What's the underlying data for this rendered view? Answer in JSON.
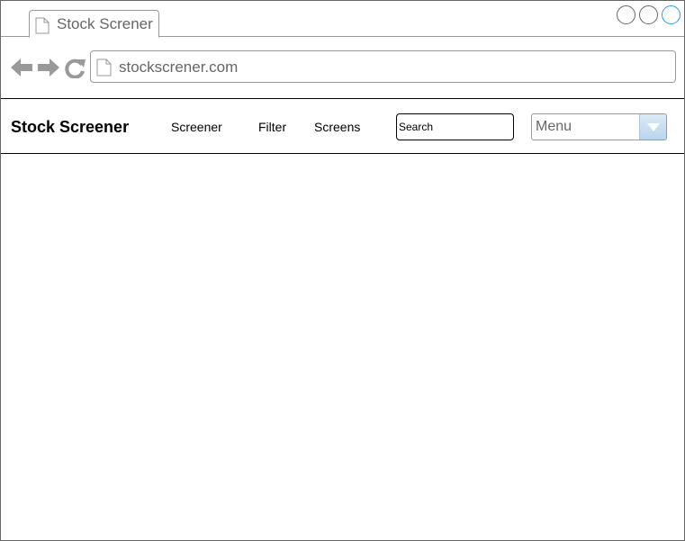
{
  "browser": {
    "tab_title": "Stock Screner",
    "url": "stockscrener.com",
    "icons": {
      "tab": "page-icon",
      "back": "arrow-left-icon",
      "forward": "arrow-right-icon",
      "reload": "reload-icon",
      "url": "page-icon"
    },
    "window_buttons": [
      "minimize",
      "maximize",
      "close"
    ],
    "accent_color": "#1ba1e2"
  },
  "navbar": {
    "brand": "Stock Screener",
    "links": [
      "Screener",
      "Filter",
      "Screens"
    ],
    "search": {
      "placeholder": "Search",
      "value": ""
    },
    "menu": {
      "selected": "Menu",
      "icon": "dropdown-arrow-icon"
    }
  }
}
